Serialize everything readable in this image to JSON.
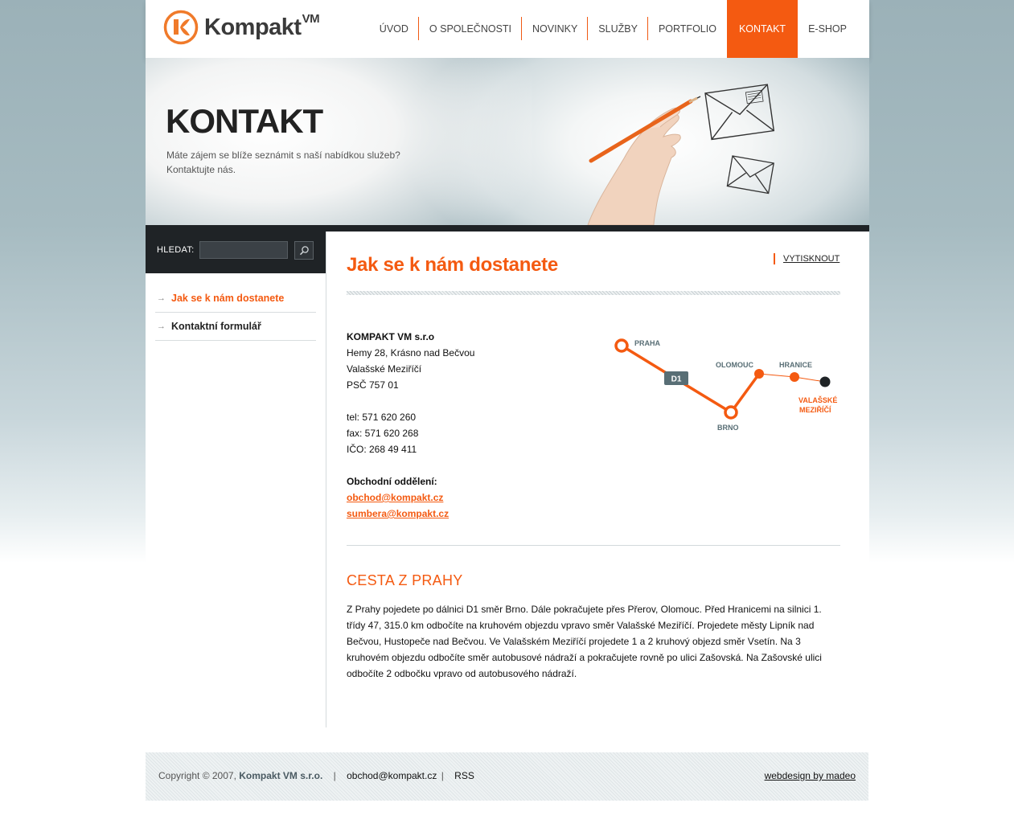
{
  "brand": {
    "name": "Kompakt",
    "suffix": "VM",
    "accent": "#f45a11"
  },
  "nav": {
    "items": [
      {
        "label": "ÚVOD",
        "active": false
      },
      {
        "label": "O SPOLEČNOSTI",
        "active": false
      },
      {
        "label": "NOVINKY",
        "active": false
      },
      {
        "label": "SLUŽBY",
        "active": false
      },
      {
        "label": "PORTFOLIO",
        "active": false
      },
      {
        "label": "KONTAKT",
        "active": true
      },
      {
        "label": "E-SHOP",
        "active": false
      }
    ]
  },
  "banner": {
    "title": "KONTAKT",
    "subtitle_line1": "Máte zájem se blíže seznámit s naší nabídkou služeb?",
    "subtitle_line2": "Kontaktujte nás."
  },
  "search": {
    "label": "HLEDAT:",
    "value": "",
    "button_icon": "search-icon"
  },
  "sidebar": {
    "items": [
      {
        "label": "Jak se k nám dostanete",
        "active": true
      },
      {
        "label": "Kontaktní formulář",
        "active": false
      }
    ]
  },
  "main": {
    "title": "Jak se k nám dostanete",
    "print_label": "VYTISKNOUT",
    "company": "KOMPAKT VM s.r.o",
    "street": "Hemy 28, Krásno nad Bečvou",
    "city": "Valašské Meziříčí",
    "zip": "PSČ 757 01",
    "tel": "tel: 571 620 260",
    "fax": "fax: 571 620 268",
    "ico": "IČO: 268 49 411",
    "dept_label": "Obchodní oddělení:",
    "email1": "obchod@kompakt.cz",
    "email2": "sumbera@kompakt.cz",
    "section_title": "CESTA Z PRAHY",
    "directions": "Z Prahy pojedete po dálnici D1 směr Brno. Dále pokračujete přes Přerov, Olomouc. Před Hranicemi na silnici 1. třídy 47, 315.0 km odbočíte na kruhovém objezdu vpravo směr Valašské Meziříčí. Projedete městy Lipník nad Bečvou, Hustopeče nad Bečvou. Ve Valašském Meziříčí projedete 1 a 2 kruhový objezd směr Vsetín. Na 3 kruhovém objezdu odbočíte směr autobusové nádraží a pokračujete rovně po ulici Zašovská. Na Zašovské ulici odbočíte 2 odbočku vpravo od autobusového nádraží."
  },
  "route_map": {
    "road_label": "D1",
    "cities": {
      "praha": "PRAHA",
      "brno": "BRNO",
      "olomouc": "OLOMOUC",
      "hranice": "HRANICE",
      "valmez_1": "VALAŠSKÉ",
      "valmez_2": "MEZIŘÍČÍ"
    }
  },
  "footer": {
    "copyright": "Copyright © 2007,",
    "company": "Kompakt VM s.r.o.",
    "sep": "|",
    "email": "obchod@kompakt.cz",
    "sep2": "|",
    "rss": "RSS",
    "credit": "webdesign by madeo"
  }
}
